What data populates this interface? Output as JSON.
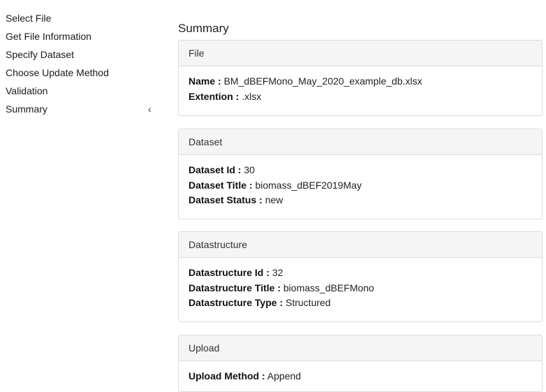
{
  "sidebar": {
    "items": [
      {
        "label": "Select File"
      },
      {
        "label": "Get File Information"
      },
      {
        "label": "Specify Dataset"
      },
      {
        "label": "Choose Update Method"
      },
      {
        "label": "Validation"
      },
      {
        "label": "Summary",
        "active": true,
        "indicator": "‹"
      }
    ]
  },
  "main": {
    "title": "Summary",
    "file": {
      "heading": "File",
      "name_label": "Name :",
      "name_value": "BM_dBEFMono_May_2020_example_db.xlsx",
      "ext_label": "Extention :",
      "ext_value": ".xlsx"
    },
    "dataset": {
      "heading": "Dataset",
      "id_label": "Dataset Id :",
      "id_value": "30",
      "title_label": "Dataset Title :",
      "title_value": "biomass_dBEF2019May",
      "status_label": "Dataset Status :",
      "status_value": "new"
    },
    "datastructure": {
      "heading": "Datastructure",
      "id_label": "Datastructure Id :",
      "id_value": "32",
      "title_label": "Datastructure Title :",
      "title_value": "biomass_dBEFMono",
      "type_label": "Datastructure Type :",
      "type_value": "Structured"
    },
    "upload": {
      "heading": "Upload",
      "method_label": "Upload Method :",
      "method_value": "Append"
    }
  }
}
